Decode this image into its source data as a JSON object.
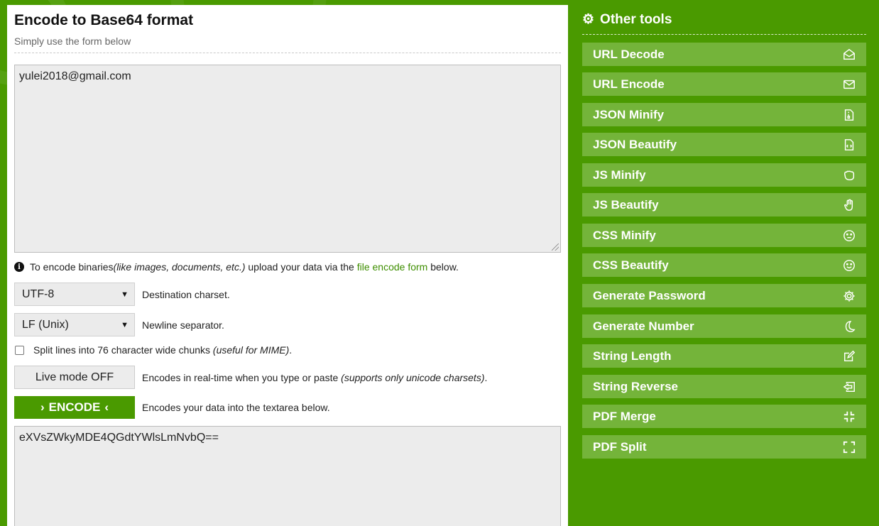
{
  "header": {
    "title": "Encode to Base64 format",
    "subtitle": "Simply use the form below"
  },
  "input": {
    "value": "yulei2018@gmail.com"
  },
  "info": {
    "prefix": "To encode binaries ",
    "italic": "(like images, documents, etc.)",
    "middle": " upload your data via the ",
    "link": "file encode form",
    "suffix": " below."
  },
  "charset": {
    "value": "UTF-8",
    "label": "Destination charset."
  },
  "newline": {
    "value": "LF (Unix)",
    "label": "Newline separator."
  },
  "split": {
    "label": "Split lines into 76 character wide chunks ",
    "italic": "(useful for MIME)",
    "suffix": ".",
    "checked": false
  },
  "live": {
    "button": "Live mode OFF",
    "label": "Encodes in real-time when you type or paste ",
    "italic": "(supports only unicode charsets)",
    "suffix": "."
  },
  "encode": {
    "button": "ENCODE",
    "label": "Encodes your data into the textarea below."
  },
  "output": {
    "value": "eXVsZWkyMDE4QGdtYWlsLmNvbQ=="
  },
  "sidebar": {
    "heading": "Other tools",
    "heading_icon": "gear-icon",
    "items": [
      {
        "label": "URL Decode",
        "icon": "envelope-open-icon"
      },
      {
        "label": "URL Encode",
        "icon": "envelope-icon"
      },
      {
        "label": "JSON Minify",
        "icon": "file-zipper-icon"
      },
      {
        "label": "JSON Beautify",
        "icon": "file-code-icon"
      },
      {
        "label": "JS Minify",
        "icon": "hand-rock-icon"
      },
      {
        "label": "JS Beautify",
        "icon": "hand-paper-icon"
      },
      {
        "label": "CSS Minify",
        "icon": "meh-face-icon"
      },
      {
        "label": "CSS Beautify",
        "icon": "smile-face-icon"
      },
      {
        "label": "Generate Password",
        "icon": "cog-icon"
      },
      {
        "label": "Generate Number",
        "icon": "moon-icon"
      },
      {
        "label": "String Length",
        "icon": "edit-icon"
      },
      {
        "label": "String Reverse",
        "icon": "reply-icon"
      },
      {
        "label": "PDF Merge",
        "icon": "compress-icon"
      },
      {
        "label": "PDF Split",
        "icon": "expand-icon"
      }
    ]
  },
  "colors": {
    "brand_green": "#4a9a00",
    "tool_bg": "#74b43a",
    "link": "#3e8e00"
  }
}
